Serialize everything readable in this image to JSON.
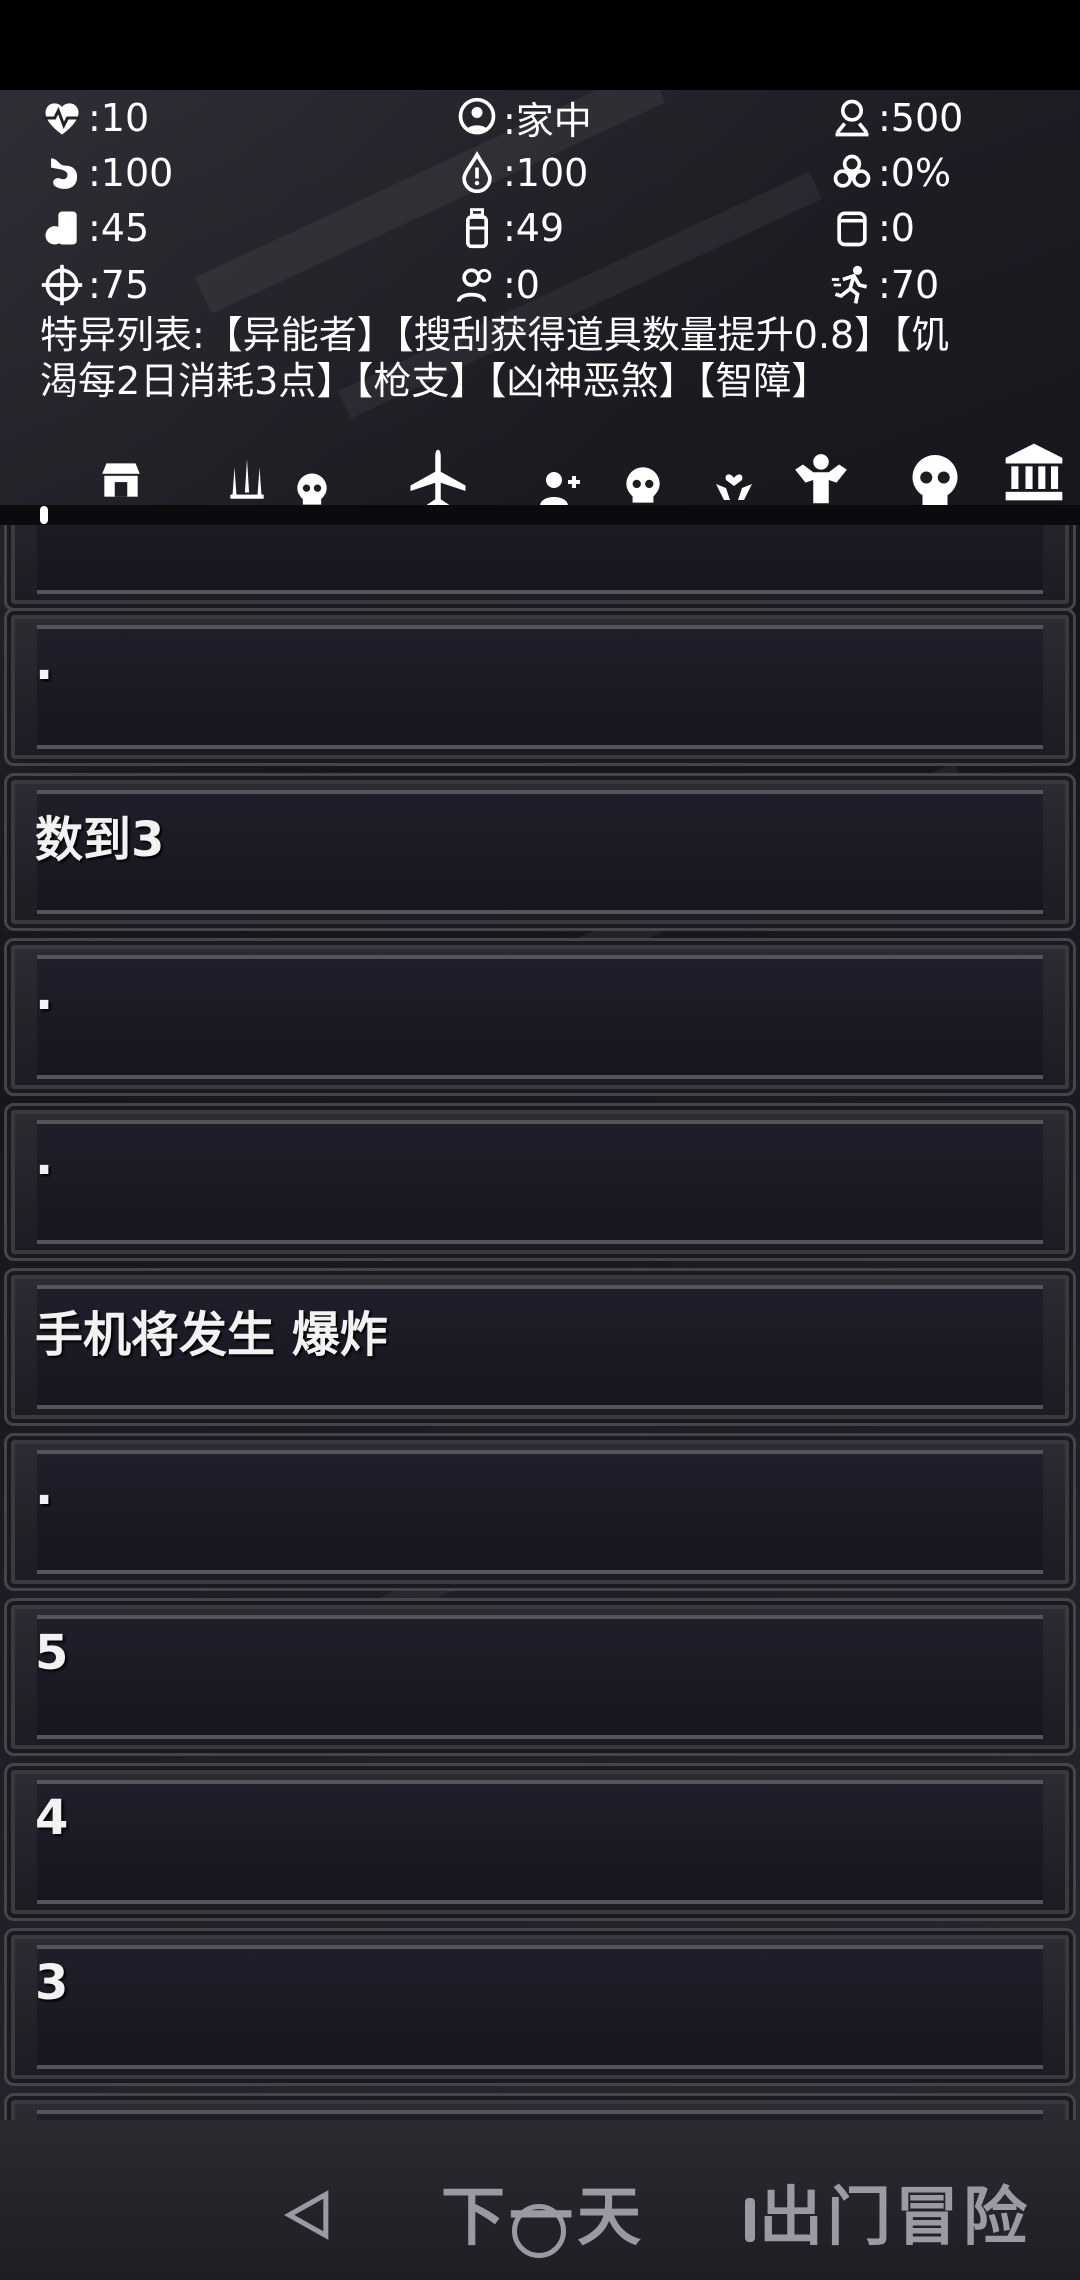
{
  "stats": [
    {
      "icon": "heartbeat-icon",
      "value": ":10"
    },
    {
      "icon": "globe-person-icon",
      "value": ":家中"
    },
    {
      "icon": "location-pin-icon",
      "value": ":500"
    },
    {
      "icon": "stomach-icon",
      "value": ":100"
    },
    {
      "icon": "water-drop-icon",
      "value": ":100"
    },
    {
      "icon": "biohazard-icon",
      "value": ":0%"
    },
    {
      "icon": "food-can-icon",
      "value": ":45"
    },
    {
      "icon": "water-bottle-icon",
      "value": ":49"
    },
    {
      "icon": "box-icon",
      "value": ":0"
    },
    {
      "icon": "crosshair-icon",
      "value": ":75"
    },
    {
      "icon": "people-icon",
      "value": ":0"
    },
    {
      "icon": "running-person-icon",
      "value": ":70"
    }
  ],
  "traits": {
    "line1": "特异列表:【异能者】【搜刮获得道具数量提升0.8】【饥",
    "line2": "渴每2日消耗3点】【枪支】【凶神恶煞】【智障】"
  },
  "toolbar": [
    {
      "name": "shop-icon"
    },
    {
      "name": "weapons-icon"
    },
    {
      "name": "skull-small-icon"
    },
    {
      "name": "airplane-icon"
    },
    {
      "name": "add-person-icon"
    },
    {
      "name": "skull-icon"
    },
    {
      "name": "hands-heart-icon"
    },
    {
      "name": "strength-icon"
    },
    {
      "name": "skull-large-icon"
    },
    {
      "name": "bank-icon"
    }
  ],
  "log": [
    {
      "text": ""
    },
    {
      "text": "."
    },
    {
      "text": "数到3"
    },
    {
      "text": "."
    },
    {
      "text": "."
    },
    {
      "text": "手机将发生 爆炸"
    },
    {
      "text": "."
    },
    {
      "text": "5"
    },
    {
      "text": "4"
    },
    {
      "text": "3"
    },
    {
      "text": ""
    }
  ],
  "bottom": {
    "next_day": "下一天",
    "go_out": "出门冒险"
  }
}
